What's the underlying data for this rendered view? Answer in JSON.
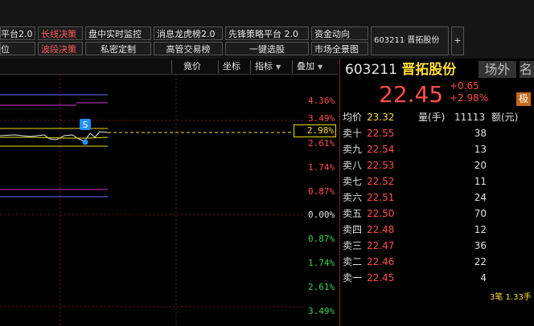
{
  "toolbar": {
    "row1": [
      "平台2.0",
      "长线决策",
      "盘中实时监控",
      "消息龙虎榜2.0",
      "先锋策略平台 2.0",
      "资金动向"
    ],
    "row2": [
      "位",
      "波段决策",
      "私密定制",
      "高管交易榜",
      "一键选股",
      "市场全景图"
    ],
    "stock_tab": "603211 晋拓股份",
    "add_tab": "+"
  },
  "chart_toolbar": {
    "price": "竟价",
    "coord": "坐标",
    "indicator": "指标",
    "overlay": "叠加"
  },
  "chart": {
    "badge": "S",
    "current_pct": "2.98%",
    "pct_labels": [
      {
        "text": "4.36%",
        "color": "red"
      },
      {
        "text": "3.49%",
        "color": "red"
      },
      {
        "text": "2.61%",
        "color": "red"
      },
      {
        "text": "1.74%",
        "color": "red"
      },
      {
        "text": "0.87%",
        "color": "red"
      },
      {
        "text": "0.00%",
        "color": "white"
      },
      {
        "text": "0.87%",
        "color": "green"
      },
      {
        "text": "1.74%",
        "color": "green"
      },
      {
        "text": "2.61%",
        "color": "green"
      },
      {
        "text": "3.49%",
        "color": "green"
      }
    ]
  },
  "quote": {
    "code": "603211",
    "name": "晋拓股份",
    "tab_outside": "场外",
    "tab_name": "名",
    "price": "22.45",
    "change": "+0.65",
    "change_pct": "+2.98%",
    "badge": "极",
    "avg_label": "均价",
    "avg_value": "23.32",
    "volume_label": "量(手)",
    "volume_value": "11113",
    "amount_label": "额(元)",
    "asks": [
      {
        "label": "卖十",
        "price": "22.55",
        "vol": "38"
      },
      {
        "label": "卖九",
        "price": "22.54",
        "vol": "13"
      },
      {
        "label": "卖八",
        "price": "22.53",
        "vol": "20"
      },
      {
        "label": "卖七",
        "price": "22.52",
        "vol": "11"
      },
      {
        "label": "卖六",
        "price": "22.51",
        "vol": "24"
      },
      {
        "label": "卖五",
        "price": "22.50",
        "vol": "70"
      },
      {
        "label": "卖四",
        "price": "22.48",
        "vol": "12"
      },
      {
        "label": "卖三",
        "price": "22.47",
        "vol": "36"
      },
      {
        "label": "卖二",
        "price": "22.46",
        "vol": "22"
      },
      {
        "label": "卖一",
        "price": "22.45",
        "vol": "4"
      }
    ],
    "footer": "3笔 1.33手"
  },
  "colors": {
    "up": "#ff4d4d",
    "down": "#39d353",
    "neutral": "#e0e0e0",
    "accent": "#ffdd33"
  }
}
